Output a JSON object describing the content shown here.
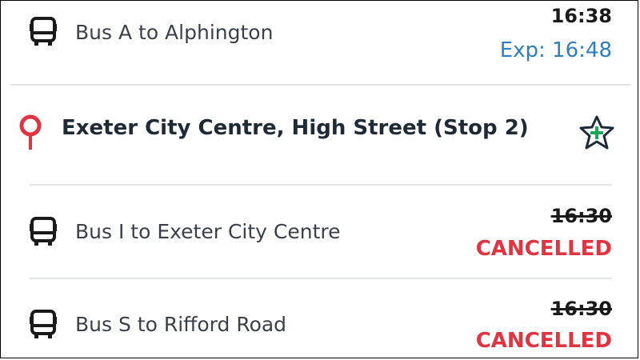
{
  "departures_top": [
    {
      "icon": "bus-icon",
      "destination": "Bus A to Alphington",
      "scheduled": "16:38",
      "status": "Exp: 16:48",
      "status_type": "expected"
    }
  ],
  "stop": {
    "icon": "map-pin-icon",
    "name": "Exeter City Centre, High Street (Stop 2)",
    "favourite_icon": "add-favourite-star-icon"
  },
  "departures": [
    {
      "icon": "bus-icon",
      "destination": "Bus I to Exeter City Centre",
      "scheduled": "16:30",
      "status": "CANCELLED",
      "status_type": "cancelled"
    },
    {
      "icon": "bus-icon",
      "destination": "Bus S to Rifford Road",
      "scheduled": "16:30",
      "status": "CANCELLED",
      "status_type": "cancelled"
    }
  ],
  "colors": {
    "expected": "#2e7fc1",
    "cancelled": "#e23340",
    "pin": "#e23340",
    "star_plus": "#1aa85a",
    "divider": "#e3e4e6"
  }
}
